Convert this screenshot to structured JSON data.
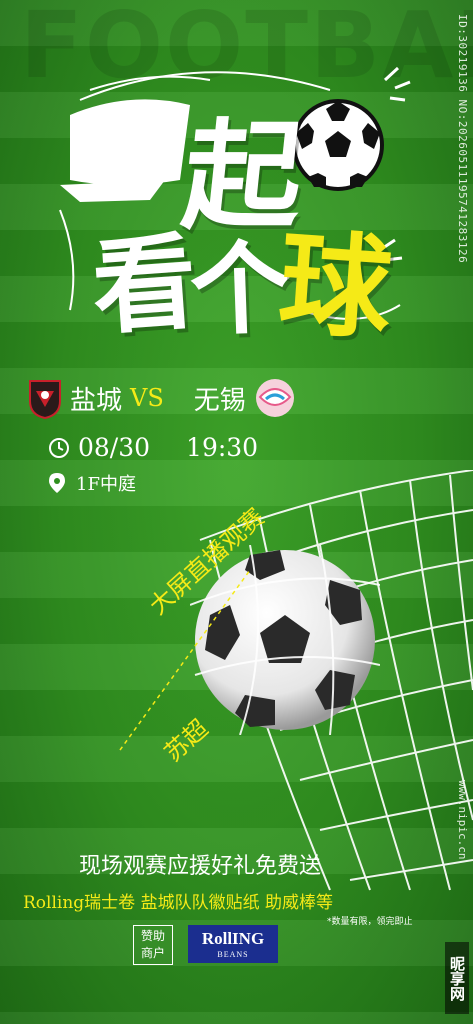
{
  "background_word": "FOOTBALL",
  "title": {
    "line1_char1": "一",
    "line1_char2": "起",
    "line2_char1": "看",
    "line2_char2": "个",
    "line2_char3": "球"
  },
  "match": {
    "home_team": "盐城",
    "vs": "VS",
    "away_team": "无锡",
    "date": "08/30",
    "time": "19:30",
    "location": "1F中庭"
  },
  "slogan": {
    "line1": "大屏直播观赛",
    "line2": "苏超"
  },
  "promo": {
    "headline": "现场观赛应援好礼免费送",
    "gifts": "Rolling瑞士卷  盐城队队徽贴纸  助威棒等",
    "note": "*数量有限，领完即止"
  },
  "sponsor": {
    "label": "赞助商户",
    "brand_name": "RollING",
    "brand_sub": "BEANS"
  },
  "watermark": {
    "id": "ID:30219136 NO:20260511195741283126",
    "site": "www.nipic.cn",
    "brand": "昵享网"
  },
  "colors": {
    "grass": "#2f8f1f",
    "accent_yellow": "#f5ea17",
    "text": "#ffffff"
  }
}
